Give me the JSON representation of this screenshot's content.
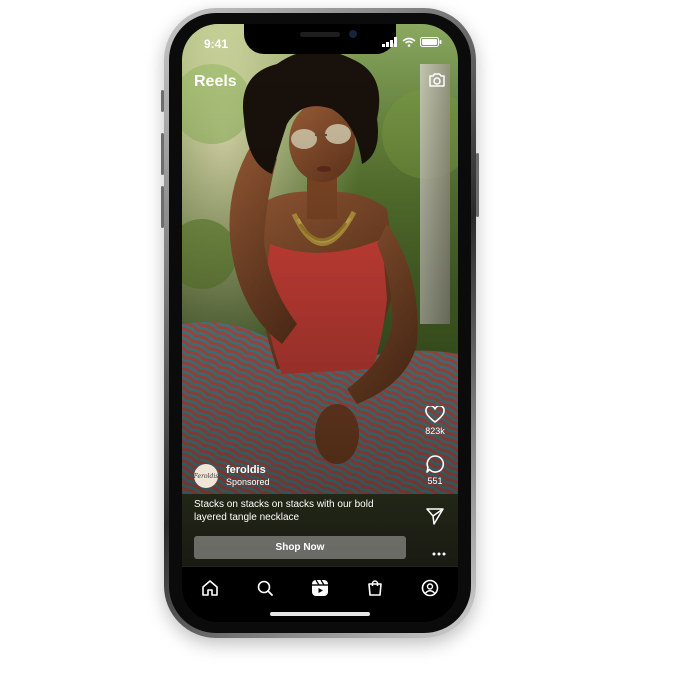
{
  "status_bar": {
    "time": "9:41"
  },
  "header": {
    "title": "Reels",
    "camera_icon": "camera-icon"
  },
  "actions": {
    "like": {
      "icon": "heart-icon",
      "count": "823k"
    },
    "comment": {
      "icon": "comment-icon",
      "count": "551"
    },
    "share": {
      "icon": "send-icon"
    },
    "more": {
      "icon": "more-icon"
    }
  },
  "post": {
    "avatar_text": "Feroldis",
    "username": "feroldis",
    "sponsored": "Sponsored",
    "caption": "Stacks on stacks on stacks with our bold layered tangle necklace",
    "cta": "Shop Now"
  },
  "tabbar": {
    "items": [
      {
        "icon": "home-icon"
      },
      {
        "icon": "search-icon"
      },
      {
        "icon": "reels-icon",
        "active": true
      },
      {
        "icon": "shop-icon"
      },
      {
        "icon": "profile-icon"
      }
    ]
  },
  "colors": {
    "top_color": "#e8493f",
    "pants_teal": "#4fa8b0",
    "pants_coral": "#d9635a",
    "foliage": "#6e8f3a"
  }
}
